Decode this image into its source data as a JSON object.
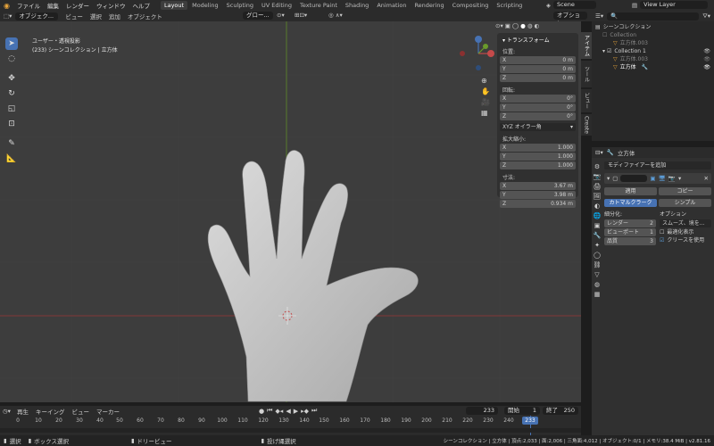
{
  "topbar": {
    "menu": [
      "ファイル",
      "編集",
      "レンダー",
      "ウィンドウ",
      "ヘルプ"
    ],
    "workspaces": [
      "Layout",
      "Modeling",
      "Sculpting",
      "UV Editing",
      "Texture Paint",
      "Shading",
      "Animation",
      "Rendering",
      "Compositing",
      "Scripting"
    ],
    "active_workspace": "Layout",
    "scene": "Scene",
    "view_layer": "View Layer"
  },
  "viewport_header": {
    "mode": "オブジェク...",
    "menus": [
      "ビュー",
      "選択",
      "追加",
      "オブジェクト"
    ],
    "transform_orientation": "グロー...",
    "options": "オプション"
  },
  "viewport": {
    "view_name": "ユーザー・透視投影",
    "collection_info": "(233) シーンコレクション | 立方体"
  },
  "npanel": {
    "title": "トランスフォーム",
    "location_label": "位置:",
    "location": [
      {
        "axis": "X",
        "value": "0 m"
      },
      {
        "axis": "Y",
        "value": "0 m"
      },
      {
        "axis": "Z",
        "value": "0 m"
      }
    ],
    "rotation_label": "回転:",
    "rotation": [
      {
        "axis": "X",
        "value": "0°"
      },
      {
        "axis": "Y",
        "value": "0°"
      },
      {
        "axis": "Z",
        "value": "0°"
      }
    ],
    "rotation_mode": "XYZ オイラー角",
    "scale_label": "拡大縮小:",
    "scale": [
      {
        "axis": "X",
        "value": "1.000"
      },
      {
        "axis": "Y",
        "value": "1.000"
      },
      {
        "axis": "Z",
        "value": "1.000"
      }
    ],
    "dimensions_label": "寸法:",
    "dimensions": [
      {
        "axis": "X",
        "value": "3.67 m"
      },
      {
        "axis": "Y",
        "value": "3.98 m"
      },
      {
        "axis": "Z",
        "value": "0.934 m"
      }
    ],
    "tabs": [
      "アイテム",
      "ツール",
      "ビュー",
      "Create"
    ]
  },
  "outliner": {
    "root": "シーンコレクション",
    "items": [
      {
        "name": "Collection",
        "depth": 1
      },
      {
        "name": "立方体.003",
        "depth": 2
      },
      {
        "name": "Collection 1",
        "depth": 1
      },
      {
        "name": "立方体.003",
        "depth": 2
      },
      {
        "name": "立方体",
        "depth": 2
      }
    ]
  },
  "properties": {
    "object_name": "立方体",
    "add_modifier": "モディファイアーを追加",
    "apply": "適用",
    "copy": "コピー",
    "catmull": "カトマルクラーク",
    "simple": "シンプル",
    "subdivision_label": "細分化:",
    "render_label": "レンダー",
    "render_value": "2",
    "viewport_label": "ビューポート",
    "viewport_value": "1",
    "quality_label": "品質",
    "quality_value": "3",
    "options_label": "オプション",
    "uv_smooth": "スムーズ、境を...",
    "optimal_display": "最適化表示",
    "use_creases": "クリースを使用"
  },
  "timeline": {
    "menus": [
      "再生",
      "キーイング",
      "ビュー",
      "マーカー"
    ],
    "current_frame": "233",
    "start_label": "開始",
    "start": "1",
    "end_label": "終了",
    "end": "250",
    "ticks": [
      "0",
      "10",
      "20",
      "30",
      "40",
      "50",
      "60",
      "70",
      "80",
      "90",
      "100",
      "110",
      "120",
      "130",
      "140",
      "150",
      "160",
      "170",
      "180",
      "190",
      "200",
      "210",
      "220",
      "230",
      "240",
      "250"
    ],
    "ruler_current": "233"
  },
  "statusbar": {
    "select": "選択",
    "box_select": "ボックス選択",
    "dolly": "ドリービュー",
    "lasso": "投げ縄選択",
    "stats": "シーンコレクション | 立方体 | 頂点:2,033 | 面:2,006 | 三角面:4,012 | オブジェクト:0/1 | メモリ:38.4 MiB | v2.81.16"
  },
  "colors": {
    "accent": "#4772b3",
    "x_axis": "#b63c3c",
    "y_axis": "#6a9a2b"
  }
}
